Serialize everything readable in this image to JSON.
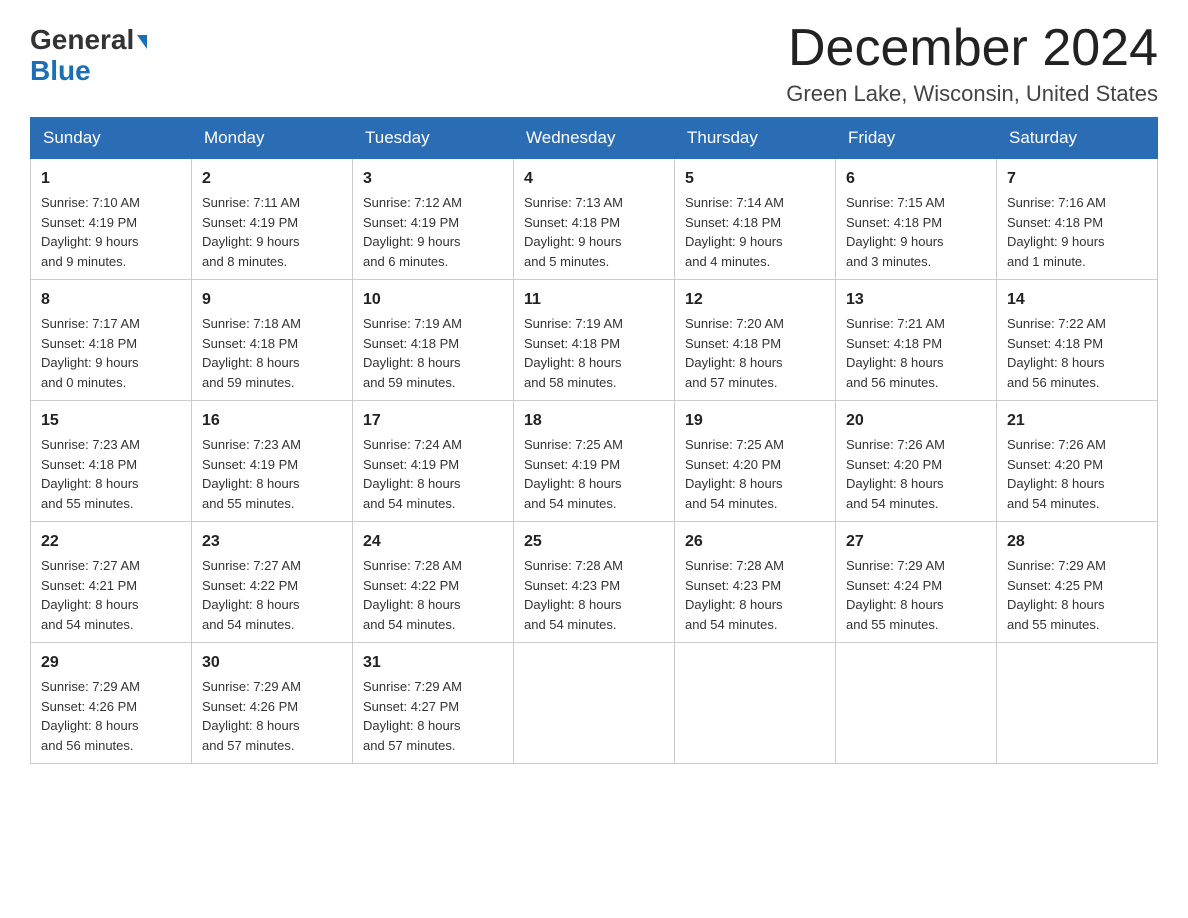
{
  "header": {
    "logo_general": "General",
    "logo_blue": "Blue",
    "month_year": "December 2024",
    "location": "Green Lake, Wisconsin, United States"
  },
  "days_of_week": [
    "Sunday",
    "Monday",
    "Tuesday",
    "Wednesday",
    "Thursday",
    "Friday",
    "Saturday"
  ],
  "weeks": [
    [
      {
        "day": "1",
        "info": "Sunrise: 7:10 AM\nSunset: 4:19 PM\nDaylight: 9 hours\nand 9 minutes."
      },
      {
        "day": "2",
        "info": "Sunrise: 7:11 AM\nSunset: 4:19 PM\nDaylight: 9 hours\nand 8 minutes."
      },
      {
        "day": "3",
        "info": "Sunrise: 7:12 AM\nSunset: 4:19 PM\nDaylight: 9 hours\nand 6 minutes."
      },
      {
        "day": "4",
        "info": "Sunrise: 7:13 AM\nSunset: 4:18 PM\nDaylight: 9 hours\nand 5 minutes."
      },
      {
        "day": "5",
        "info": "Sunrise: 7:14 AM\nSunset: 4:18 PM\nDaylight: 9 hours\nand 4 minutes."
      },
      {
        "day": "6",
        "info": "Sunrise: 7:15 AM\nSunset: 4:18 PM\nDaylight: 9 hours\nand 3 minutes."
      },
      {
        "day": "7",
        "info": "Sunrise: 7:16 AM\nSunset: 4:18 PM\nDaylight: 9 hours\nand 1 minute."
      }
    ],
    [
      {
        "day": "8",
        "info": "Sunrise: 7:17 AM\nSunset: 4:18 PM\nDaylight: 9 hours\nand 0 minutes."
      },
      {
        "day": "9",
        "info": "Sunrise: 7:18 AM\nSunset: 4:18 PM\nDaylight: 8 hours\nand 59 minutes."
      },
      {
        "day": "10",
        "info": "Sunrise: 7:19 AM\nSunset: 4:18 PM\nDaylight: 8 hours\nand 59 minutes."
      },
      {
        "day": "11",
        "info": "Sunrise: 7:19 AM\nSunset: 4:18 PM\nDaylight: 8 hours\nand 58 minutes."
      },
      {
        "day": "12",
        "info": "Sunrise: 7:20 AM\nSunset: 4:18 PM\nDaylight: 8 hours\nand 57 minutes."
      },
      {
        "day": "13",
        "info": "Sunrise: 7:21 AM\nSunset: 4:18 PM\nDaylight: 8 hours\nand 56 minutes."
      },
      {
        "day": "14",
        "info": "Sunrise: 7:22 AM\nSunset: 4:18 PM\nDaylight: 8 hours\nand 56 minutes."
      }
    ],
    [
      {
        "day": "15",
        "info": "Sunrise: 7:23 AM\nSunset: 4:18 PM\nDaylight: 8 hours\nand 55 minutes."
      },
      {
        "day": "16",
        "info": "Sunrise: 7:23 AM\nSunset: 4:19 PM\nDaylight: 8 hours\nand 55 minutes."
      },
      {
        "day": "17",
        "info": "Sunrise: 7:24 AM\nSunset: 4:19 PM\nDaylight: 8 hours\nand 54 minutes."
      },
      {
        "day": "18",
        "info": "Sunrise: 7:25 AM\nSunset: 4:19 PM\nDaylight: 8 hours\nand 54 minutes."
      },
      {
        "day": "19",
        "info": "Sunrise: 7:25 AM\nSunset: 4:20 PM\nDaylight: 8 hours\nand 54 minutes."
      },
      {
        "day": "20",
        "info": "Sunrise: 7:26 AM\nSunset: 4:20 PM\nDaylight: 8 hours\nand 54 minutes."
      },
      {
        "day": "21",
        "info": "Sunrise: 7:26 AM\nSunset: 4:20 PM\nDaylight: 8 hours\nand 54 minutes."
      }
    ],
    [
      {
        "day": "22",
        "info": "Sunrise: 7:27 AM\nSunset: 4:21 PM\nDaylight: 8 hours\nand 54 minutes."
      },
      {
        "day": "23",
        "info": "Sunrise: 7:27 AM\nSunset: 4:22 PM\nDaylight: 8 hours\nand 54 minutes."
      },
      {
        "day": "24",
        "info": "Sunrise: 7:28 AM\nSunset: 4:22 PM\nDaylight: 8 hours\nand 54 minutes."
      },
      {
        "day": "25",
        "info": "Sunrise: 7:28 AM\nSunset: 4:23 PM\nDaylight: 8 hours\nand 54 minutes."
      },
      {
        "day": "26",
        "info": "Sunrise: 7:28 AM\nSunset: 4:23 PM\nDaylight: 8 hours\nand 54 minutes."
      },
      {
        "day": "27",
        "info": "Sunrise: 7:29 AM\nSunset: 4:24 PM\nDaylight: 8 hours\nand 55 minutes."
      },
      {
        "day": "28",
        "info": "Sunrise: 7:29 AM\nSunset: 4:25 PM\nDaylight: 8 hours\nand 55 minutes."
      }
    ],
    [
      {
        "day": "29",
        "info": "Sunrise: 7:29 AM\nSunset: 4:26 PM\nDaylight: 8 hours\nand 56 minutes."
      },
      {
        "day": "30",
        "info": "Sunrise: 7:29 AM\nSunset: 4:26 PM\nDaylight: 8 hours\nand 57 minutes."
      },
      {
        "day": "31",
        "info": "Sunrise: 7:29 AM\nSunset: 4:27 PM\nDaylight: 8 hours\nand 57 minutes."
      },
      {
        "day": "",
        "info": ""
      },
      {
        "day": "",
        "info": ""
      },
      {
        "day": "",
        "info": ""
      },
      {
        "day": "",
        "info": ""
      }
    ]
  ]
}
